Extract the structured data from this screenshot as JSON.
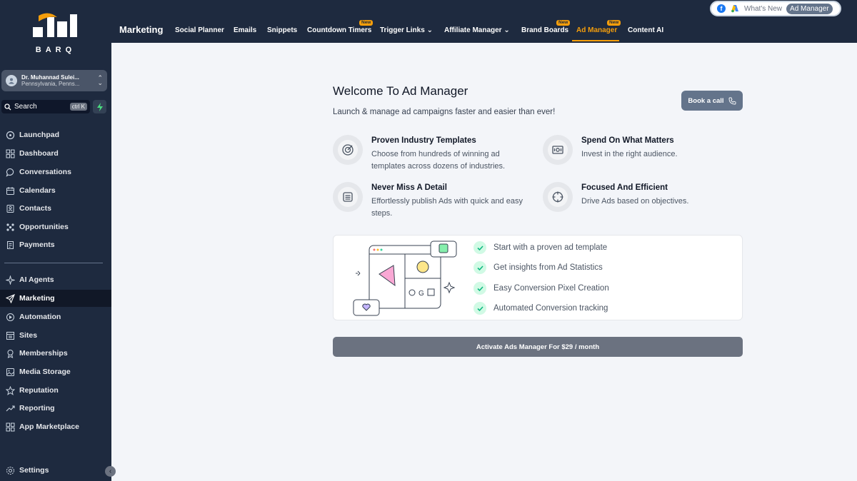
{
  "brand": {
    "name": "BARQ",
    "accent": "#f59e0b",
    "sidebar_bg": "#1e2a3f"
  },
  "account": {
    "name": "Dr. Muhannad Sulei...",
    "location": "Pennsylvania, Penns..."
  },
  "search": {
    "label": "Search",
    "shortcut": "ctrl K"
  },
  "sidebar": {
    "items": [
      {
        "label": "Launchpad",
        "icon": "rocket-icon"
      },
      {
        "label": "Dashboard",
        "icon": "grid-icon"
      },
      {
        "label": "Conversations",
        "icon": "chat-icon"
      },
      {
        "label": "Calendars",
        "icon": "calendar-icon"
      },
      {
        "label": "Contacts",
        "icon": "contacts-icon"
      },
      {
        "label": "Opportunities",
        "icon": "opportunities-icon"
      },
      {
        "label": "Payments",
        "icon": "payments-icon"
      }
    ],
    "items2": [
      {
        "label": "AI Agents",
        "icon": "sparkle-icon"
      },
      {
        "label": "Marketing",
        "icon": "send-icon",
        "active": true
      },
      {
        "label": "Automation",
        "icon": "automation-icon"
      },
      {
        "label": "Sites",
        "icon": "sites-icon"
      },
      {
        "label": "Memberships",
        "icon": "membership-icon"
      },
      {
        "label": "Media Storage",
        "icon": "media-icon"
      },
      {
        "label": "Reputation",
        "icon": "star-icon"
      },
      {
        "label": "Reporting",
        "icon": "trend-icon"
      },
      {
        "label": "App Marketplace",
        "icon": "apps-icon"
      }
    ],
    "settings": "Settings"
  },
  "topbar": {
    "title": "Marketing",
    "links": [
      {
        "label": "Social Planner"
      },
      {
        "label": "Emails"
      },
      {
        "label": "Snippets"
      },
      {
        "label": "Countdown Timers",
        "badge": "New"
      },
      {
        "label": "Trigger Links",
        "dropdown": true
      },
      {
        "label": "Affiliate Manager",
        "dropdown": true
      },
      {
        "label": "Brand Boards",
        "badge": "New"
      },
      {
        "label": "Ad Manager",
        "badge": "New",
        "active": true
      },
      {
        "label": "Content AI"
      }
    ],
    "whats_new": "What's New",
    "ad_manager_pill": "Ad Manager"
  },
  "main": {
    "heading": "Welcome To Ad Manager",
    "subheading": "Launch & manage ad campaigns faster and easier than ever!",
    "book_call": "Book a call",
    "features": [
      {
        "title": "Proven Industry Templates",
        "desc": "Choose from hundreds of winning ad templates across dozens of industries.",
        "icon": "target-icon"
      },
      {
        "title": "Spend On What Matters",
        "desc": "Invest in the right audience.",
        "icon": "money-icon"
      },
      {
        "title": "Never Miss A Detail",
        "desc": "Effortlessly publish Ads with quick and easy steps.",
        "icon": "list-icon"
      },
      {
        "title": "Focused And Efficient",
        "desc": "Drive Ads based on objectives.",
        "icon": "crosshair-icon"
      }
    ],
    "checklist": [
      "Start with a proven ad template",
      "Get insights from Ad Statistics",
      "Easy Conversion Pixel Creation",
      "Automated Conversion tracking"
    ],
    "activate": "Activate Ads Manager For $29 / month"
  }
}
